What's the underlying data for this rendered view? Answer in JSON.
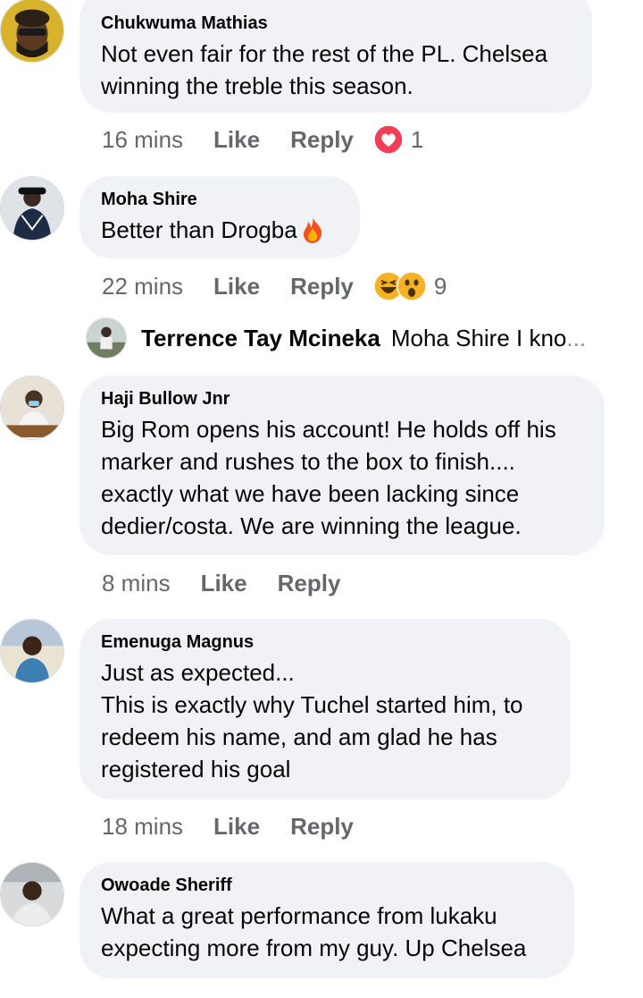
{
  "comments": [
    {
      "author": "Chukwuma Mathias",
      "text": "Not even fair for the rest of the PL. Chelsea winning the treble this season.",
      "time": "16 mins",
      "like": "Like",
      "reply": "Reply",
      "reaction_icons": [
        "heart-reaction-icon"
      ],
      "reaction_count": "1"
    },
    {
      "author": "Moha Shire",
      "text": "Better than Drogba",
      "text_emoji": "fire-emoji-icon",
      "time": "22 mins",
      "like": "Like",
      "reply": "Reply",
      "reaction_icons": [
        "haha-reaction-icon",
        "wow-reaction-icon"
      ],
      "reaction_count": "9"
    },
    {
      "author": "Haji Bullow Jnr",
      "text": "Big Rom opens his account! He holds off his\nmarker and rushes to the box to finish....\nexactly what we have been lacking since\ndedier/costa. We are winning the league.",
      "time": "8 mins",
      "like": "Like",
      "reply": "Reply"
    },
    {
      "author": "Emenuga Magnus",
      "text": "Just as expected...\nThis is exactly why Tuchel started him, to\nredeem his name, and am glad he has\nregistered his goal",
      "time": "18 mins",
      "like": "Like",
      "reply": "Reply"
    },
    {
      "author": "Owoade Sheriff",
      "text": "What a great performance from lukaku\nexpecting more from my guy. Up Chelsea"
    }
  ],
  "reply_preview": {
    "author": "Terrence Tay Mcineka",
    "text": "Moha Shire I kno",
    "ellipsis": "..."
  },
  "colors": {
    "bubble": "#f0f2f5",
    "meta_text": "#65676b",
    "heart": "#f33e58",
    "like_blue": "#1877f2",
    "haha_yellow": "#f7b125"
  }
}
